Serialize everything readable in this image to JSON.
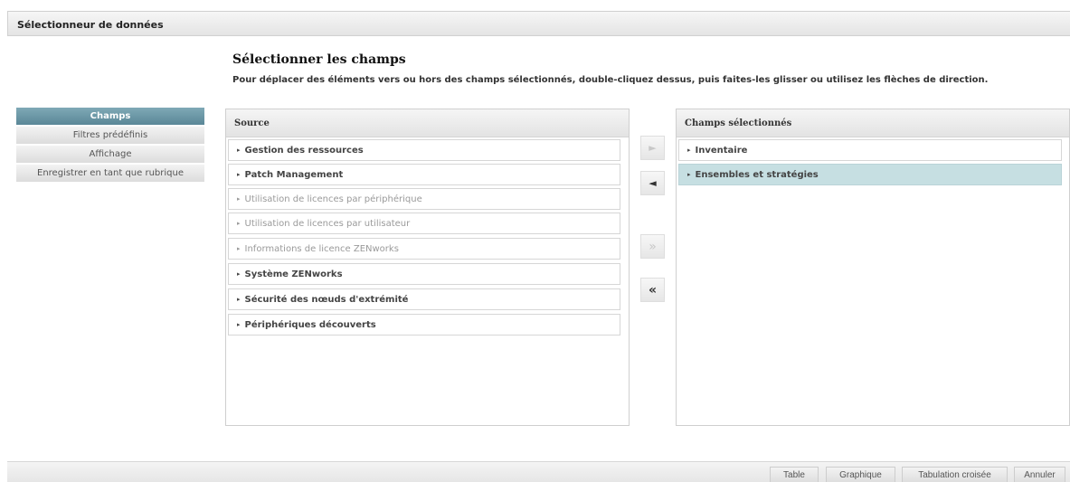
{
  "window": {
    "title": "Sélectionneur de données"
  },
  "header": {
    "title": "Sélectionner les champs",
    "instructions": "Pour déplacer des éléments vers ou hors des champs sélectionnés, double-cliquez dessus, puis faites-les glisser ou utilisez les flèches de direction."
  },
  "nav": {
    "items": [
      {
        "label": "Champs",
        "active": true
      },
      {
        "label": "Filtres prédéfinis",
        "active": false
      },
      {
        "label": "Affichage",
        "active": false
      },
      {
        "label": "Enregistrer en tant que rubrique",
        "active": false
      }
    ]
  },
  "source": {
    "title": "Source",
    "items": [
      {
        "label": "Gestion des ressources",
        "enabled": true
      },
      {
        "label": "Patch Management",
        "enabled": true
      },
      {
        "label": "Utilisation de licences par périphérique",
        "enabled": false
      },
      {
        "label": "Utilisation de licences par utilisateur",
        "enabled": false
      },
      {
        "label": "Informations de licence ZENworks",
        "enabled": false
      },
      {
        "label": "Système ZENworks",
        "enabled": true
      },
      {
        "label": "Sécurité des nœuds d'extrémité",
        "enabled": true
      },
      {
        "label": "Périphériques découverts",
        "enabled": true
      }
    ]
  },
  "selected": {
    "title": "Champs sélectionnés",
    "items": [
      {
        "label": "Inventaire",
        "selected": false
      },
      {
        "label": "Ensembles et stratégies",
        "selected": true
      }
    ]
  },
  "arrows": {
    "add": {
      "glyph": "►",
      "enabled": false
    },
    "remove": {
      "glyph": "◄",
      "enabled": true
    },
    "add_all": {
      "glyph": "»",
      "enabled": false
    },
    "remove_all": {
      "glyph": "«",
      "enabled": true
    }
  },
  "tree_arrow_glyph": "▸",
  "footer": {
    "table_label": "Table",
    "chart_label": "Graphique",
    "crosstab_label": "Tabulation croisée",
    "cancel_label": "Annuler"
  },
  "colors": {
    "accent": "#5a8797",
    "selection": "#c6dfe2"
  }
}
